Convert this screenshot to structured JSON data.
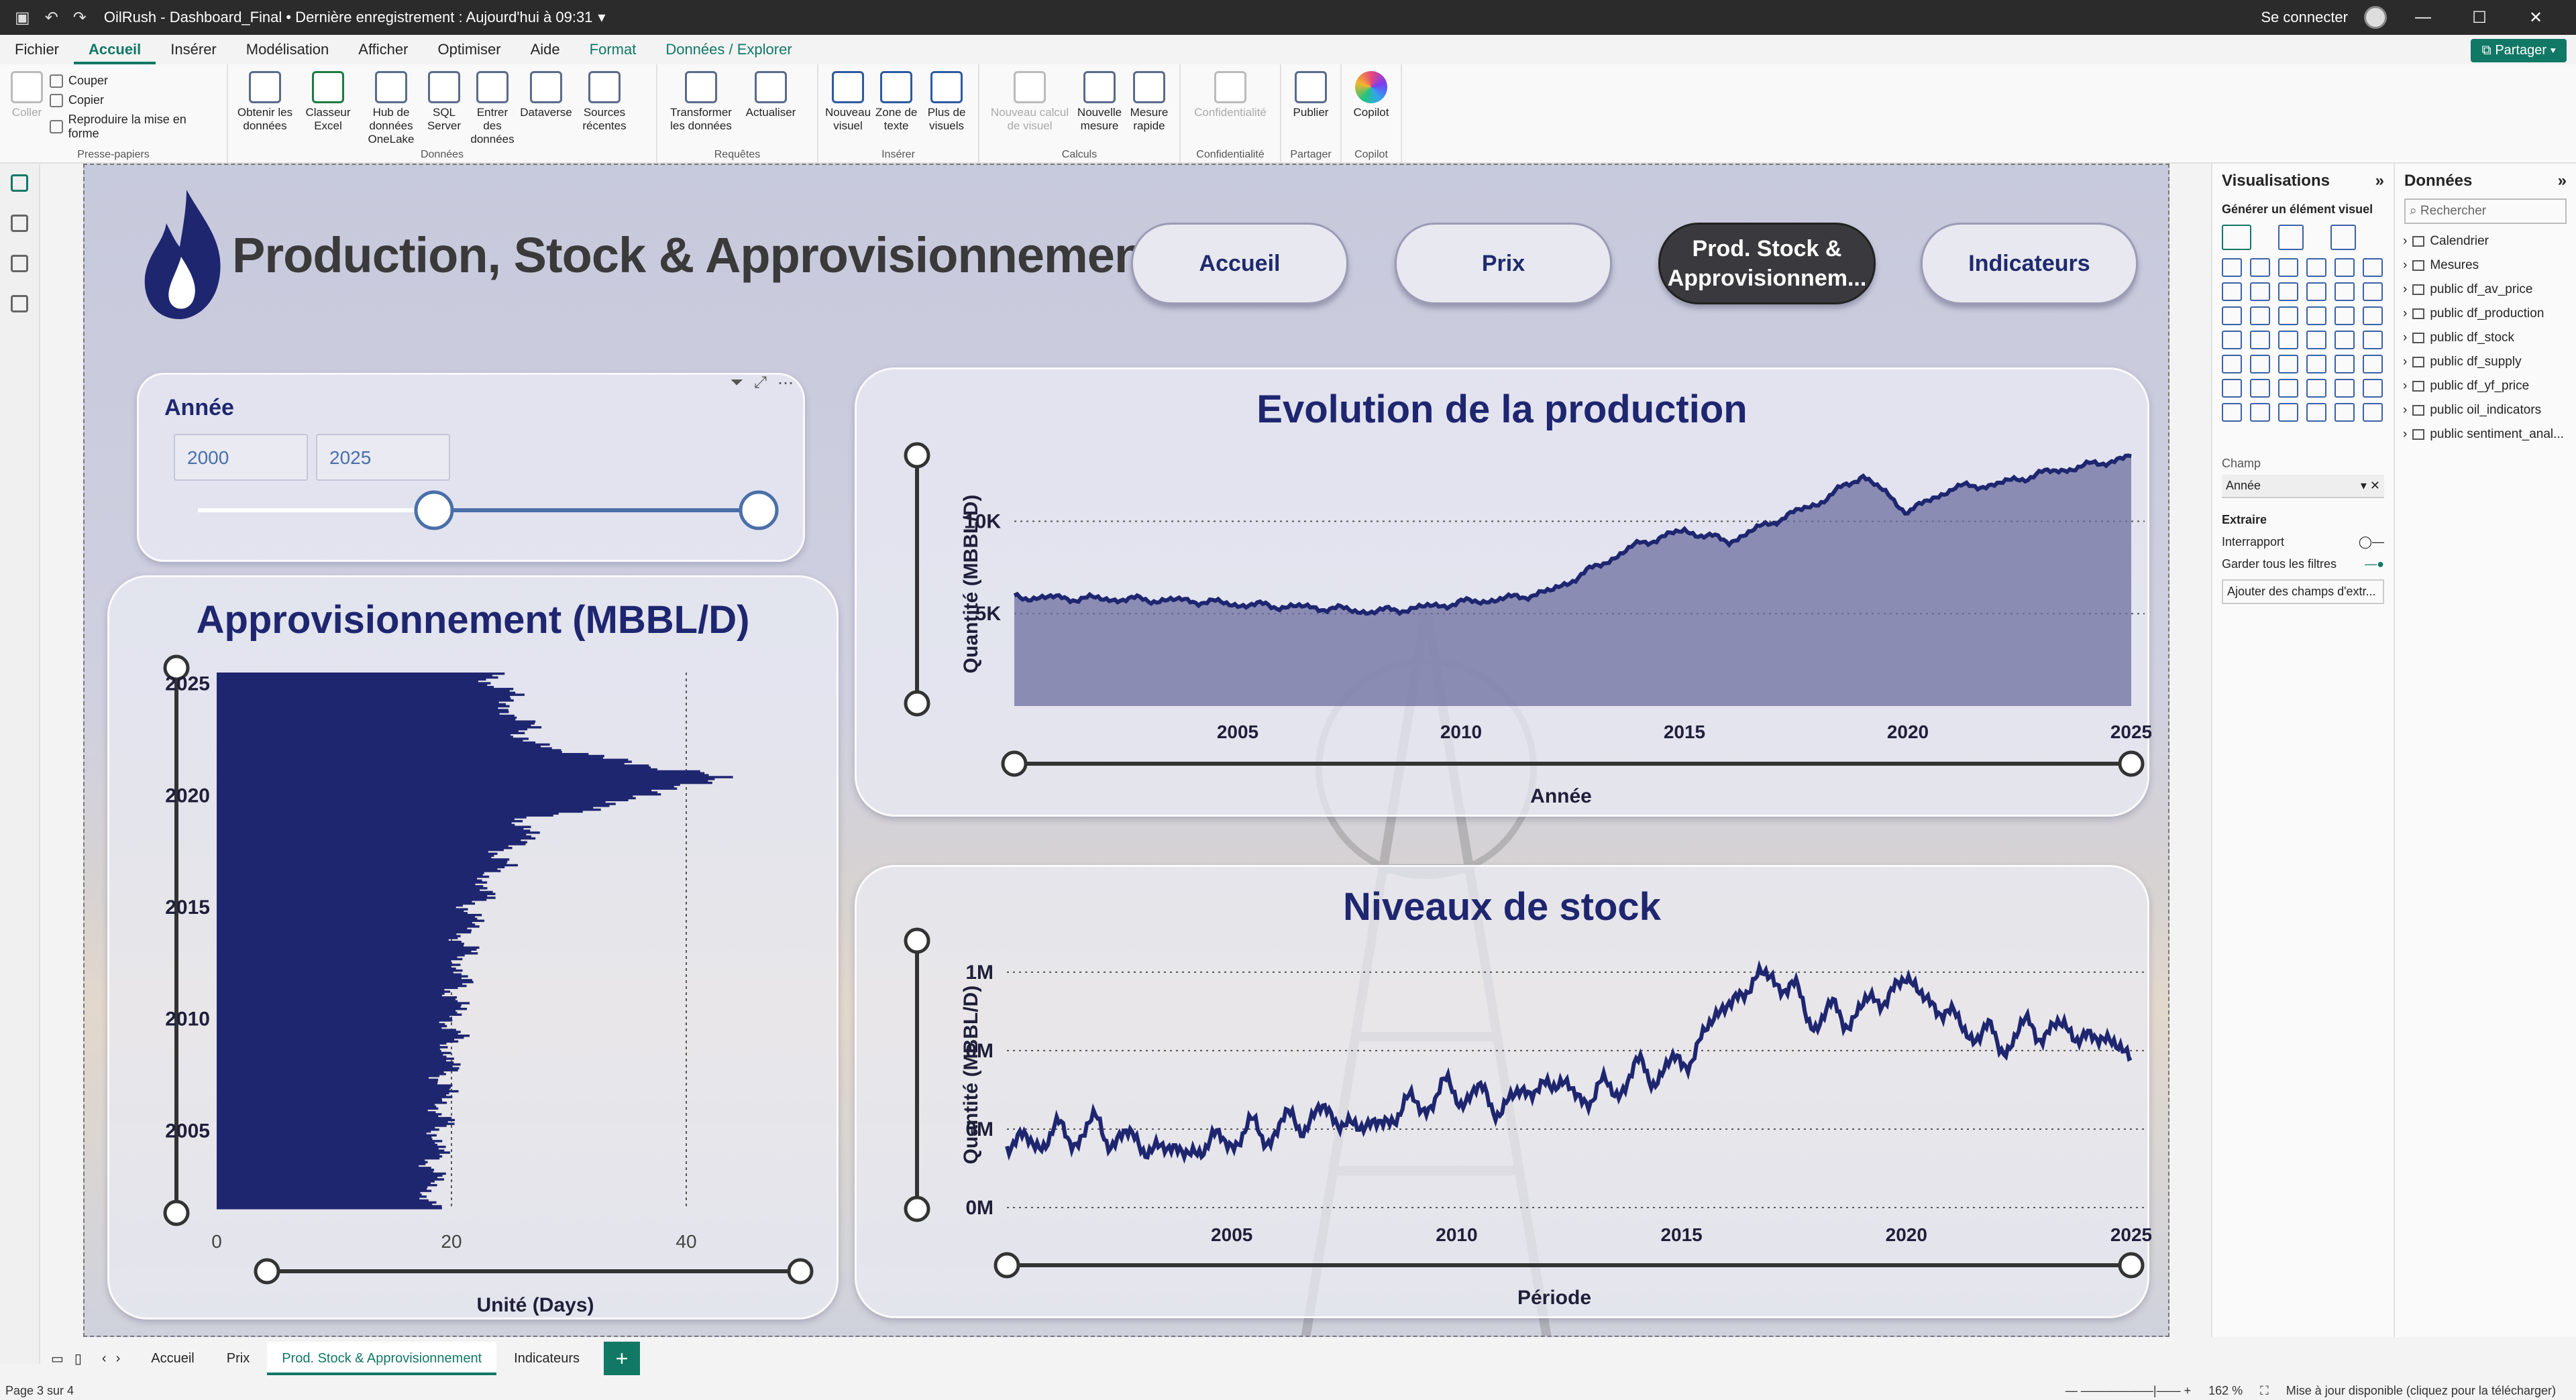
{
  "titlebar": {
    "doc": "OilRush - Dashboard_Final • Dernière enregistrement : Aujourd'hui à 09:31",
    "signin": "Se connecter"
  },
  "menu": {
    "tabs": [
      "Fichier",
      "Accueil",
      "Insérer",
      "Modélisation",
      "Afficher",
      "Optimiser",
      "Aide",
      "Format",
      "Données / Explorer"
    ],
    "share": "Partager"
  },
  "ribbon": {
    "clipboard": {
      "paste": "Coller",
      "cut": "Couper",
      "copy": "Copier",
      "format": "Reproduire la mise en forme",
      "label": "Presse-papiers"
    },
    "data": {
      "items": [
        "Obtenir les données",
        "Classeur Excel",
        "Hub de données OneLake",
        "SQL Server",
        "Entrer des données",
        "Dataverse",
        "Sources récentes"
      ],
      "label": "Données"
    },
    "queries": {
      "items": [
        "Transformer les données",
        "Actualiser"
      ],
      "label": "Requêtes"
    },
    "insert": {
      "items": [
        "Nouveau visuel",
        "Zone de texte",
        "Plus de visuels"
      ],
      "label": "Insérer"
    },
    "calc": {
      "items": [
        "Nouveau calcul de visuel",
        "Nouvelle mesure",
        "Mesure rapide"
      ],
      "label": "Calculs"
    },
    "sensitivity": {
      "items": [
        "Confidentialité"
      ],
      "label": "Confidentialité"
    },
    "share": {
      "items": [
        "Publier"
      ],
      "label": "Partager"
    },
    "copilot": {
      "items": [
        "Copilot"
      ],
      "label": "Copilot"
    }
  },
  "report": {
    "title": "Production, Stock & Approvisionnement",
    "nav": [
      "Accueil",
      "Prix",
      "Prod. Stock & Approvisionnem...",
      "Indicateurs"
    ],
    "slicer": {
      "title": "Année",
      "from": "2000",
      "to": "2025"
    },
    "supply_title": "Approvisionnement (MBBL/D)",
    "supply_xlabel": "Unité (Days)",
    "production_title": "Evolution de la production",
    "production_ylabel": "Quantité (MBBL/D)",
    "production_xlabel": "Année",
    "stock_title": "Niveaux de stock",
    "stock_ylabel": "Quantité (MBBL/D)",
    "stock_xlabel": "Période"
  },
  "chart_data": [
    {
      "type": "bar",
      "orientation": "horizontal",
      "title": "Approvisionnement (MBBL/D)",
      "xlabel": "Unité (Days)",
      "y_ticks": [
        "2025",
        "2020",
        "2015",
        "2010",
        "2005"
      ],
      "x_ticks": [
        "0",
        "20",
        "40"
      ],
      "xlim": [
        0,
        40
      ],
      "ylim": [
        2001.5,
        2025.5
      ],
      "series": [
        {
          "x": [
            2001.5,
            2003,
            2005,
            2007,
            2009,
            2011,
            2013,
            2015,
            2016,
            2017,
            2018,
            2019,
            2020,
            2021,
            2022,
            2023,
            2024,
            2025
          ],
          "values": [
            18,
            18.5,
            19,
            19.5,
            20,
            20.5,
            21,
            22,
            23,
            24,
            26,
            27,
            38,
            42,
            28,
            26,
            25,
            24
          ]
        }
      ]
    },
    {
      "type": "area",
      "title": "Evolution de la production",
      "ylabel": "Quantité (MBBL/D)",
      "xlabel": "Année",
      "x_ticks": [
        "2005",
        "2010",
        "2015",
        "2020",
        "2025"
      ],
      "y_ticks": [
        "5K",
        "10K"
      ],
      "xlim": [
        2000,
        2025
      ],
      "ylim": [
        0,
        13500
      ],
      "series": [
        {
          "x": [
            2000,
            2002,
            2004,
            2005,
            2006,
            2007,
            2008,
            2009,
            2010,
            2011,
            2012,
            2013,
            2014,
            2015,
            2016,
            2017,
            2018,
            2019,
            2020,
            2021,
            2022,
            2023,
            2024,
            2025
          ],
          "values": [
            5900,
            5800,
            5700,
            5500,
            5400,
            5300,
            5100,
            5300,
            5600,
            5800,
            6200,
            7500,
            8800,
            9500,
            8900,
            10000,
            11000,
            12500,
            10500,
            11800,
            12000,
            12600,
            13000,
            13500
          ]
        }
      ]
    },
    {
      "type": "line",
      "title": "Niveaux de stock",
      "ylabel": "Quantité (MBBL/D)",
      "xlabel": "Période",
      "x_ticks": [
        "2005",
        "2010",
        "2015",
        "2020",
        "2025"
      ],
      "y_ticks": [
        "1M",
        "0M",
        "0M",
        "0M"
      ],
      "xlim": [
        2000,
        2025
      ],
      "ylim": [
        0,
        1.7
      ],
      "series": [
        {
          "x": [
            2000,
            2001,
            2002,
            2003,
            2004,
            2005,
            2006,
            2007,
            2008,
            2009,
            2010,
            2011,
            2012,
            2013,
            2014,
            2015,
            2016,
            2017,
            2018,
            2019,
            2020,
            2021,
            2022,
            2023,
            2024,
            2025
          ],
          "values": [
            0.4,
            0.45,
            0.5,
            0.4,
            0.35,
            0.45,
            0.5,
            0.6,
            0.5,
            0.65,
            0.75,
            0.65,
            0.8,
            0.7,
            0.85,
            0.9,
            1.3,
            1.5,
            1.2,
            1.25,
            1.45,
            1.2,
            1.05,
            1.15,
            1.1,
            1.0
          ]
        }
      ]
    }
  ],
  "pages": {
    "tabs": [
      "Accueil",
      "Prix",
      "Prod. Stock & Approvisionnement",
      "Indicateurs"
    ],
    "add": "+"
  },
  "status": {
    "page": "Page 3 sur 4",
    "zoom": "162 %",
    "update": "Mise à jour disponible (cliquez pour la télécharger)"
  },
  "viz_panel": {
    "title": "Visualisations",
    "subtitle": "Générer un élément visuel",
    "field_label": "Champ",
    "field_value": "Année",
    "drill": "Extraire",
    "cross_report": "Interrapport",
    "keep_filters": "Garder tous les filtres",
    "add_fields": "Ajouter des champs d'extr..."
  },
  "data_panel": {
    "title": "Données",
    "search_placeholder": "Rechercher",
    "tables": [
      "Calendrier",
      "Mesures",
      "public df_av_price",
      "public df_production",
      "public df_stock",
      "public df_supply",
      "public df_yf_price",
      "public oil_indicators",
      "public sentiment_anal..."
    ]
  }
}
